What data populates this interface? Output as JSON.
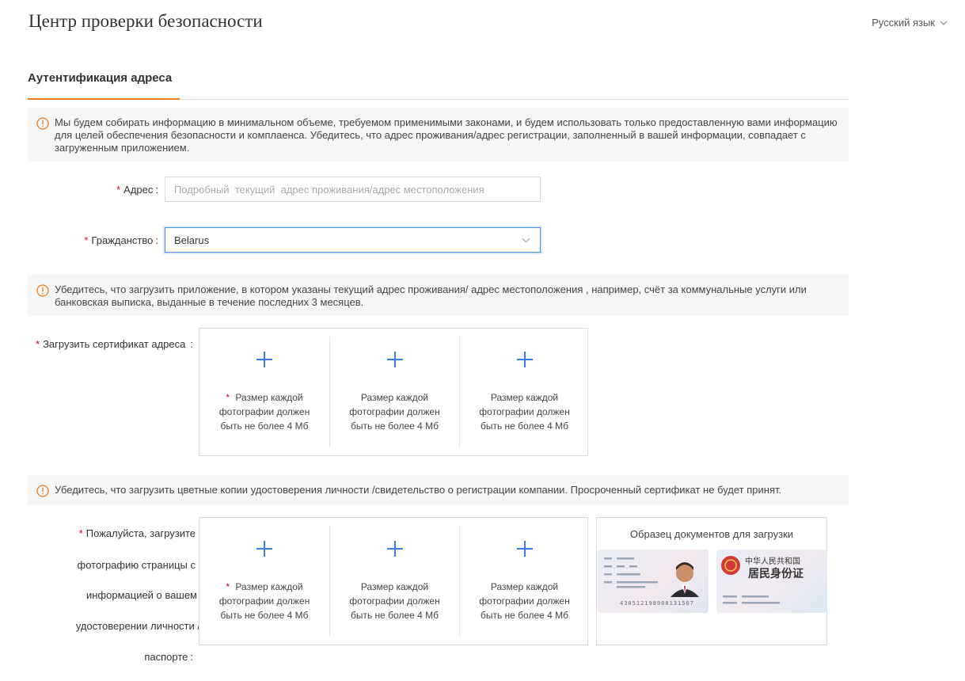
{
  "header": {
    "title": "Центр проверки безопасности",
    "language": "Русский язык"
  },
  "tabs": [
    {
      "label": "Аутентификация адреса"
    }
  ],
  "notices": {
    "privacy": "Мы будем собирать информацию в минимальном объеме, требуемом применимыми законами, и будем использовать только предоставленную вами информацию для целей обеспечения безопасности и комплаенса. Убедитесь, что адрес проживания/адрес регистрации, заполненный в вашей информации, совпадает с загруженным приложением.",
    "address_doc": "Убедитесь, что загрузить приложение, в котором указаны текущий адрес проживания/ адрес местоположения , например, счёт за коммунальные услуги или банковская выписка, выданные в течение последних 3 месяцев.",
    "id_doc": "Убедитесь, что загрузить цветные копии удостоверения личности /свидетельство о регистрации компании. Просроченный сертификат не будет принят."
  },
  "form": {
    "required_mark": "*",
    "colon": ":",
    "address": {
      "label": "Адрес",
      "placeholder": "Подробный  текущий  адрес проживания/адрес местоположения"
    },
    "citizenship": {
      "label": "Гражданство",
      "value": "Belarus"
    },
    "address_cert": {
      "label": "Загрузить сертификат адреса",
      "hint": "Размер каждой фотографии должен быть не более 4 Мб"
    },
    "id_upload": {
      "label_lines": [
        "Пожалуйста, загрузите",
        "фотографию страницы с",
        "информацией о вашем",
        "удостоверении личности /",
        "паспорте"
      ],
      "hint": "Размер каждой фотографии должен быть не более 4 Мб"
    },
    "sample": {
      "title": "Образец документов для загрузки",
      "card_number": "430512198908131567",
      "back_line1": "中华人民共和国",
      "back_line2": "居民身份证"
    }
  },
  "colors": {
    "accent": "#f07c1a",
    "primary": "#3a7ce8",
    "required": "#d9001b"
  }
}
